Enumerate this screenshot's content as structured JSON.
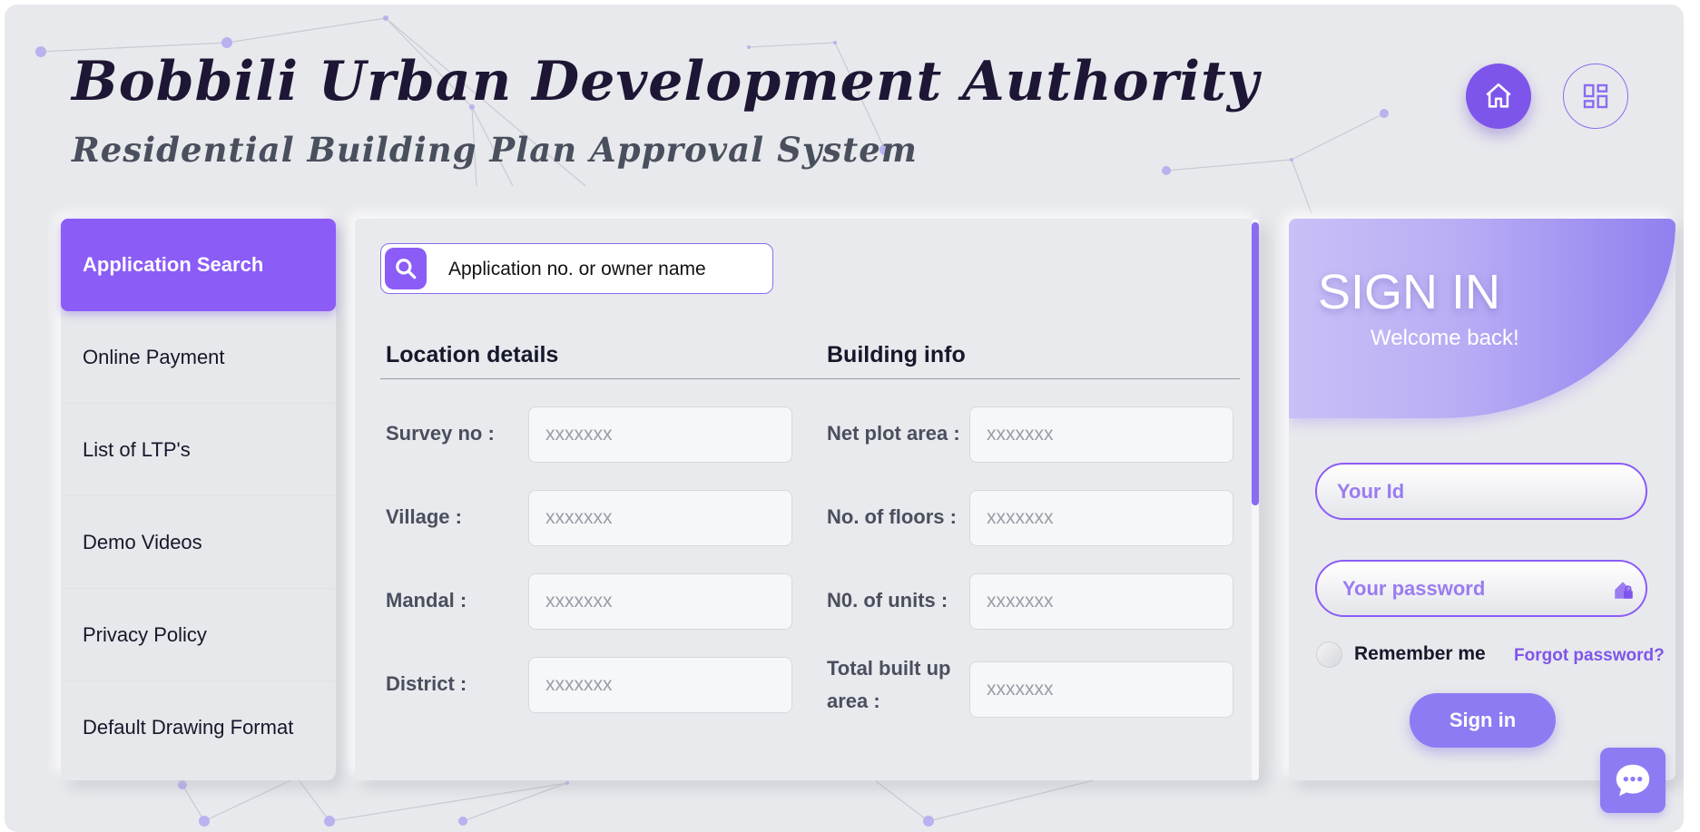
{
  "header": {
    "title": "Bobbili Urban Development Authority",
    "subtitle": "Residential Building Plan Approval System"
  },
  "top_actions": {
    "home_icon": "home-icon",
    "dashboard_icon": "dashboard-grid-icon"
  },
  "sidebar": {
    "items": [
      {
        "label": "Application Search",
        "active": true
      },
      {
        "label": "Online Payment"
      },
      {
        "label": "List of LTP's"
      },
      {
        "label": "Demo Videos"
      },
      {
        "label": "Privacy Policy"
      },
      {
        "label": "Default Drawing Format"
      }
    ]
  },
  "search": {
    "placeholder": "Application no. or owner name",
    "icon": "search-icon"
  },
  "sections": {
    "location": {
      "heading": "Location details",
      "fields": [
        {
          "label": "Survey no :",
          "placeholder": "xxxxxxx"
        },
        {
          "label": "Village :",
          "placeholder": "xxxxxxx"
        },
        {
          "label": "Mandal :",
          "placeholder": "xxxxxxx"
        },
        {
          "label": "District :",
          "placeholder": "xxxxxxx"
        }
      ]
    },
    "building": {
      "heading": "Building info",
      "fields": [
        {
          "label": "Net plot area :",
          "placeholder": "xxxxxxx"
        },
        {
          "label": "No. of floors :",
          "placeholder": "xxxxxxx"
        },
        {
          "label": "N0. of units :",
          "placeholder": "xxxxxxx"
        },
        {
          "label": "Total built up area :",
          "placeholder": "xxxxxxx"
        }
      ]
    }
  },
  "signin": {
    "title": "SIGN IN",
    "subtitle": "Welcome back!",
    "id_placeholder": "Your Id",
    "password_placeholder": "Your password",
    "remember_label": "Remember me",
    "forgot_label": "Forgot password?",
    "button_label": "Sign in"
  },
  "chat": {
    "icon": "chat-bubble-icon"
  },
  "colors": {
    "accent": "#8b5cf6",
    "title": "#1e1635",
    "subtitle": "#4a4f5e",
    "background": "#e8e9ec"
  }
}
